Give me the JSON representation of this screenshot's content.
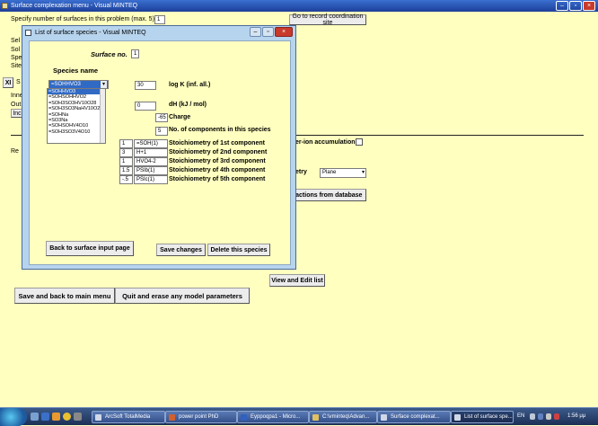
{
  "window": {
    "title": "Surface complexation menu - Visual MINTEQ"
  },
  "main": {
    "num_surfaces_label": "Specify number of surfaces in this problem (max. 5)",
    "num_surfaces_value": "1",
    "goto_record_button": "Go to record coordination site",
    "left_fragments": [
      "Sel",
      "Sol",
      "Spe",
      "Site"
    ],
    "xi_label": "XI",
    "s_label": "S",
    "inner_label": "Inne",
    "outer_label": "Out",
    "inc_button": "Inc",
    "re_label": "Re",
    "counterion_label": "er-ion accumulation",
    "etry_label": "etry",
    "plane_select": "Plane",
    "reactions_db_button": "reactions from database",
    "view_edit_button": "View and Edit list",
    "save_back_button": "Save and back to main menu",
    "quit_erase_button": "Quit and erase any model parameters"
  },
  "dialog": {
    "title": "List of surface species - Visual MINTEQ",
    "surface_no_label": "Surface no.",
    "surface_no_value": "1",
    "species_name_label": "Species name",
    "selected_species": "=SOHHVO3",
    "species_list": [
      "=SOHHVO3",
      "=SOHSOHHVO2",
      "=SOH3SO3HV10O28",
      "=SOH3SO3NaHV10O28",
      "=SOHNa",
      "=SO3Na",
      "=SOHSOHV4O10",
      "=SOH3SO3V4O10"
    ],
    "logk_value": "30",
    "logk_label": "log K (inf. all.)",
    "dh_value": "0",
    "dh_label": "dH (kJ / mol)",
    "charge_value": "-65",
    "charge_label": "Charge",
    "ncomp_value": "5",
    "ncomp_label": "No. of components in this species",
    "stoich": [
      {
        "coef": "1",
        "comp": "=SOH(1)",
        "label": "Stoichiometry of 1st component"
      },
      {
        "coef": "3",
        "comp": "H+1",
        "label": "Stoichiometry of 2nd component"
      },
      {
        "coef": "1",
        "comp": "HVO4-2",
        "label": "Stoichiometry of 3rd component"
      },
      {
        "coef": "1.5",
        "comp": "PSIb(1)",
        "label": "Stoichiometry of 4th component"
      },
      {
        "coef": "-.5",
        "comp": "PSIc(1)",
        "label": "Stoichiometry of 5th component"
      }
    ],
    "back_button": "Back to surface input page",
    "save_changes_button": "Save changes",
    "delete_button": "Delete this species"
  },
  "taskbar": {
    "items": [
      {
        "label": "ArcSoft TotalMedia"
      },
      {
        "label": "power point PhD"
      },
      {
        "label": "Eyppoqpa1 - Micro..."
      },
      {
        "label": "C:\\vminteq\\Advan..."
      },
      {
        "label": "Surface complexat..."
      },
      {
        "label": "List of surface spe..."
      }
    ],
    "lang": "EN",
    "clock": "1:56 μμ"
  }
}
